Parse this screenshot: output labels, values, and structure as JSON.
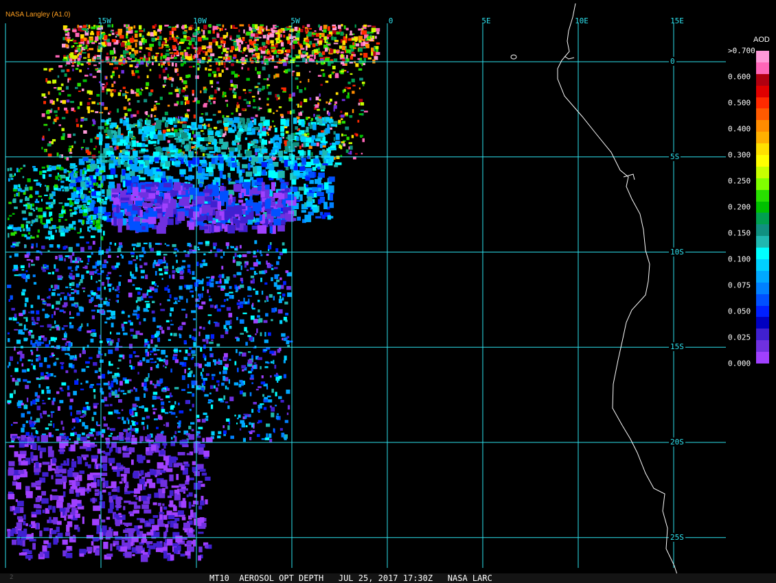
{
  "credit": "NASA Langley (A1.0)",
  "longitude_labels": [
    {
      "text": "15W",
      "lon": -15
    },
    {
      "text": "10W",
      "lon": -10
    },
    {
      "text": "5W",
      "lon": -5
    },
    {
      "text": "0",
      "lon": 0
    },
    {
      "text": "5E",
      "lon": 5
    },
    {
      "text": "10E",
      "lon": 10
    },
    {
      "text": "15E",
      "lon": 15
    }
  ],
  "latitude_labels": [
    {
      "text": "0",
      "lat": 0
    },
    {
      "text": "5S",
      "lat": -5
    },
    {
      "text": "10S",
      "lat": -10
    },
    {
      "text": "15S",
      "lat": -15
    },
    {
      "text": "20S",
      "lat": -20
    },
    {
      "text": "25S",
      "lat": -25
    }
  ],
  "legend": {
    "title": "AOD",
    "labels": [
      ">0.700",
      "0.600",
      "0.500",
      "0.400",
      "0.300",
      "0.250",
      "0.200",
      "0.150",
      "0.100",
      "0.075",
      "0.050",
      "0.025",
      "0.000"
    ],
    "colors": [
      "#ff9ad8",
      "#ff66b8",
      "#b00010",
      "#e00000",
      "#ff2a00",
      "#ff5a00",
      "#ff8c00",
      "#ffb000",
      "#ffe000",
      "#ffff00",
      "#c8ff00",
      "#80ff00",
      "#28e000",
      "#00c000",
      "#00a050",
      "#109080",
      "#20b8b0",
      "#00ffff",
      "#00d0ff",
      "#00a8ff",
      "#0080ff",
      "#0050ff",
      "#0020ff",
      "#0000c0",
      "#4020d0",
      "#7030e0",
      "#a040ff"
    ]
  },
  "footer": {
    "text": "MT10  AEROSOL OPT DEPTH   JUL 25, 2017 17:30Z   NASA LARC",
    "number": "2"
  },
  "colors": {
    "grid": "#2ee3f0",
    "coast": "#ffffff",
    "credit": "#ffa020"
  }
}
